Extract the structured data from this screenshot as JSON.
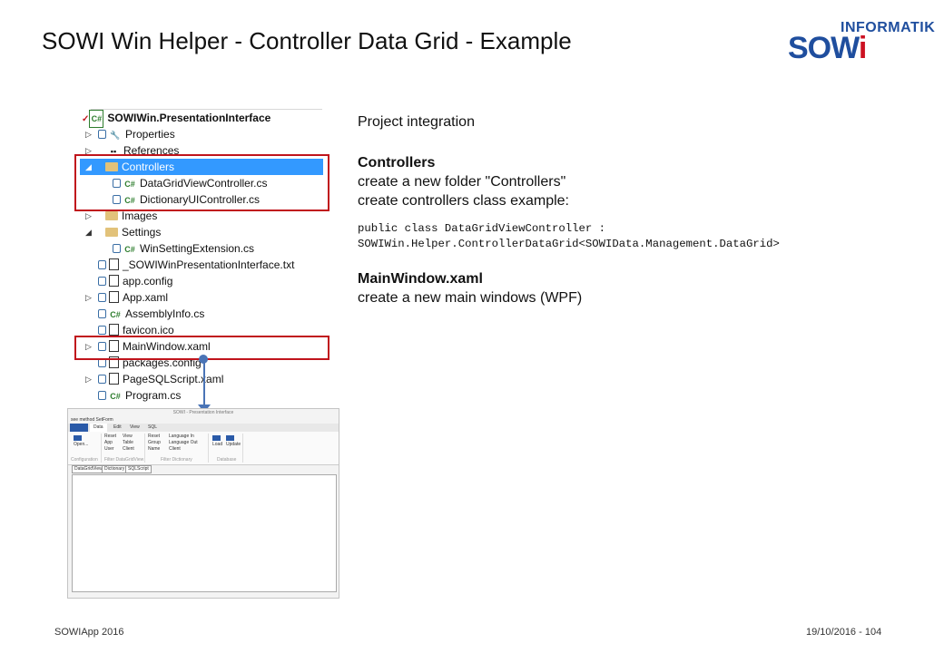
{
  "slide": {
    "title": "SOWI Win Helper - Controller Data Grid - Example"
  },
  "logo": {
    "superscript": "INFORMATIK",
    "word_start": "SOW",
    "word_end": "i",
    "colors": {
      "blue": "#1f4e9e",
      "red": "#cc1122"
    }
  },
  "solution_tree": {
    "project": "SOWIWin.PresentationInterface",
    "items": [
      {
        "label": "Properties",
        "icon": "wrench-icon"
      },
      {
        "label": "References",
        "icon": "references-icon"
      },
      {
        "label": "Controllers",
        "icon": "folder-icon",
        "selected": true
      },
      {
        "label": "DataGridViewController.cs",
        "icon": "csharp-icon"
      },
      {
        "label": "DictionaryUIController.cs",
        "icon": "csharp-icon"
      },
      {
        "label": "Images",
        "icon": "folder-icon"
      },
      {
        "label": "Settings",
        "icon": "folder-icon"
      },
      {
        "label": "WinSettingExtension.cs",
        "icon": "csharp-icon"
      },
      {
        "label": "_SOWIWinPresentationInterface.txt",
        "icon": "text-file-icon"
      },
      {
        "label": "app.config",
        "icon": "config-file-icon"
      },
      {
        "label": "App.xaml",
        "icon": "xaml-file-icon"
      },
      {
        "label": "AssemblyInfo.cs",
        "icon": "csharp-icon"
      },
      {
        "label": "favicon.ico",
        "icon": "image-file-icon"
      },
      {
        "label": "MainWindow.xaml",
        "icon": "xaml-file-icon"
      },
      {
        "label": "packages.config",
        "icon": "config-file-icon"
      },
      {
        "label": "PageSQLScript.xaml",
        "icon": "xaml-file-icon"
      },
      {
        "label": "Program.cs",
        "icon": "csharp-icon"
      }
    ],
    "csharp_glyph": "C#",
    "collapse_glyph": "▷",
    "expand_glyph": "◢"
  },
  "mini_window": {
    "title": "SOWI - Presentation Interface",
    "menu": "see method SetForm",
    "tabs": [
      "Data",
      "Edit",
      "View",
      "SQL"
    ],
    "groups": [
      "Configuration",
      "Filter DataGridView",
      "Filter Dictionary",
      "Database"
    ],
    "open_label": "Open...",
    "reset_label": "Reset",
    "view_label": "View",
    "app_label": "App",
    "table_label": "Table",
    "user_label": "User",
    "client_label": "Client",
    "group_label": "Group",
    "name_label": "Name",
    "language_in_label": "Language In",
    "language_out_label": "Language Out",
    "load_label": "Load",
    "update_label": "Update",
    "content_tabs": [
      "DataGridView",
      "Dictionary",
      "SQLScript"
    ]
  },
  "content": {
    "intro": "Project integration",
    "controllers_heading": "Controllers",
    "controllers_line1": "create a new folder \"Controllers\"",
    "controllers_line2": "create controllers class example:",
    "code_line1": "public class DataGridViewController :",
    "code_line2": "SOWIWin.Helper.ControllerDataGrid<SOWIData.Management.DataGrid>",
    "mainwindow_heading": "MainWindow.xaml",
    "mainwindow_line1": "create a new main windows (WPF)"
  },
  "footer": {
    "left": "SOWIApp 2016",
    "right": "19/10/2016 - 104"
  },
  "colors": {
    "highlight_border": "#c0141c",
    "selection": "#3399ff",
    "connector": "#4a74b6"
  }
}
